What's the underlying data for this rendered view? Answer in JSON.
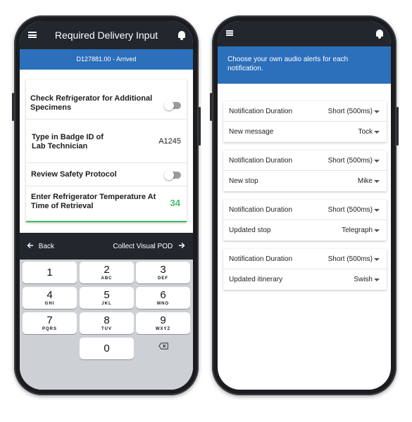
{
  "left_phone": {
    "header_title": "Required Delivery Input",
    "sub_header": "D127881.00 - Arrived",
    "rows": [
      {
        "label": "Check Refrigerator for Additional Specimens"
      },
      {
        "label": "Type in Badge ID of Lab Technician",
        "value": "A1245"
      },
      {
        "label": "Review Safety Protocol"
      },
      {
        "label": "Enter Refrigerator Temperature At Time of Retrieval",
        "value": "34"
      }
    ],
    "nav": {
      "back": "Back",
      "next": "Collect Visual POD"
    },
    "keys": [
      {
        "num": "1",
        "letters": ""
      },
      {
        "num": "2",
        "letters": "ABC"
      },
      {
        "num": "3",
        "letters": "DEF"
      },
      {
        "num": "4",
        "letters": "GHI"
      },
      {
        "num": "5",
        "letters": "JKL"
      },
      {
        "num": "6",
        "letters": "MNO"
      },
      {
        "num": "7",
        "letters": "PQRS"
      },
      {
        "num": "8",
        "letters": "TUV"
      },
      {
        "num": "9",
        "letters": "WXYZ"
      },
      {
        "num": "0",
        "letters": ""
      }
    ]
  },
  "right_phone": {
    "banner": "Choose your own audio alerts for each notification.",
    "groups": [
      {
        "duration_label": "Notification Duration",
        "duration_value": "Short (500ms)",
        "event_label": "New message",
        "event_sound": "Tock"
      },
      {
        "duration_label": "Notification Duration",
        "duration_value": "Short (500ms)",
        "event_label": "New stop",
        "event_sound": "Mike"
      },
      {
        "duration_label": "Notification Duration",
        "duration_value": "Short (500ms)",
        "event_label": "Updated stop",
        "event_sound": "Telegraph"
      },
      {
        "duration_label": "Notification Duration",
        "duration_value": "Short (500ms)",
        "event_label": "Updated itinerary",
        "event_sound": "Swish"
      }
    ]
  },
  "colors": {
    "accent_blue": "#2c6fbb",
    "dark_bar": "#22272d",
    "success_green": "#3fbf5f"
  },
  "icons": [
    "menu-icon",
    "bell-icon",
    "arrow-left-icon",
    "arrow-right-icon",
    "backspace-icon",
    "chevron-down-icon"
  ]
}
